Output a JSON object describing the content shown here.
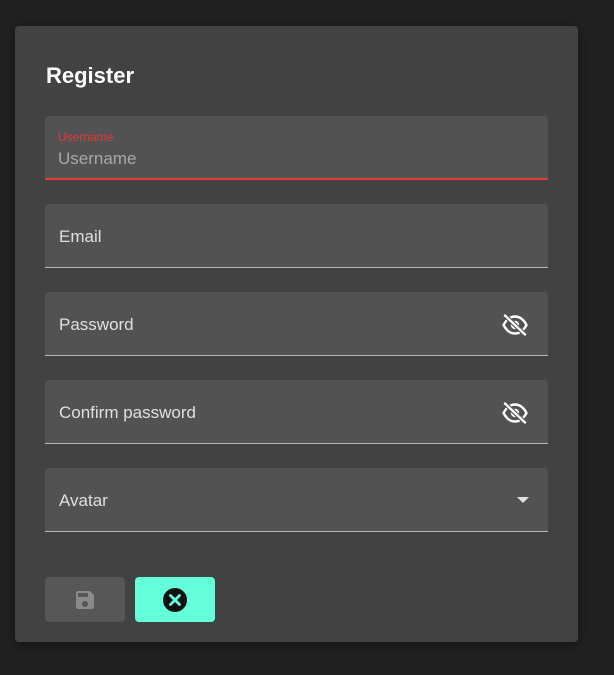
{
  "form": {
    "title": "Register",
    "username": {
      "float_label": "Username",
      "placeholder": "Username",
      "value": ""
    },
    "email": {
      "label": "Email"
    },
    "password": {
      "label": "Password",
      "icon": "eye-off-icon"
    },
    "confirm_password": {
      "label": "Confirm password",
      "icon": "eye-off-icon"
    },
    "avatar": {
      "label": "Avatar",
      "icon": "dropdown-arrow-icon"
    }
  },
  "actions": {
    "save": {
      "icon": "floppy-disk-icon",
      "state": "disabled"
    },
    "cancel": {
      "icon": "close-circle-icon"
    }
  },
  "colors": {
    "page_background": "#212121",
    "card_background": "#424242",
    "field_background": "#525252",
    "error_accent": "#e53935",
    "cancel_button": "#64ffda",
    "save_button_disabled": "#575757"
  }
}
